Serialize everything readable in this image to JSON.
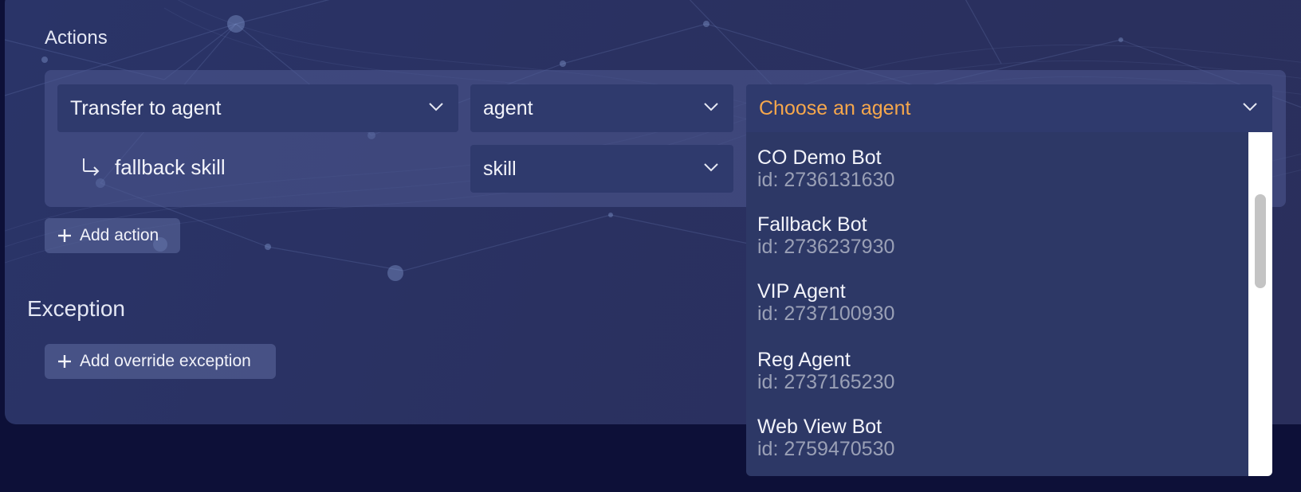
{
  "sections": {
    "actions_label": "Actions",
    "exception_label": "Exception"
  },
  "action_row": {
    "action_select": "Transfer to agent",
    "target_type_select": "agent",
    "target_select_placeholder": "Choose an agent"
  },
  "fallback_row": {
    "label": "fallback skill",
    "type_select": "skill"
  },
  "buttons": {
    "add_action": "Add action",
    "add_override_exception": "Add override exception"
  },
  "dropdown": {
    "options": [
      {
        "name": "CO Demo Bot",
        "id": "id: 2736131630"
      },
      {
        "name": "Fallback Bot",
        "id": "id: 2736237930"
      },
      {
        "name": "VIP Agent",
        "id": "id: 2737100930"
      },
      {
        "name": "Reg Agent",
        "id": "id: 2737165230"
      },
      {
        "name": "Web View Bot",
        "id": "id: 2759470530"
      }
    ],
    "scroll_position": 0.2
  },
  "icons": {
    "chevron": "chevron-down-icon",
    "return_arrow": "return-arrow-icon",
    "plus": "plus-icon"
  },
  "colors": {
    "placeholder_accent": "#f6a74c",
    "page_background": "#0d1038",
    "panel_background": "#2a3161",
    "select_background": "#2f3a6d"
  }
}
